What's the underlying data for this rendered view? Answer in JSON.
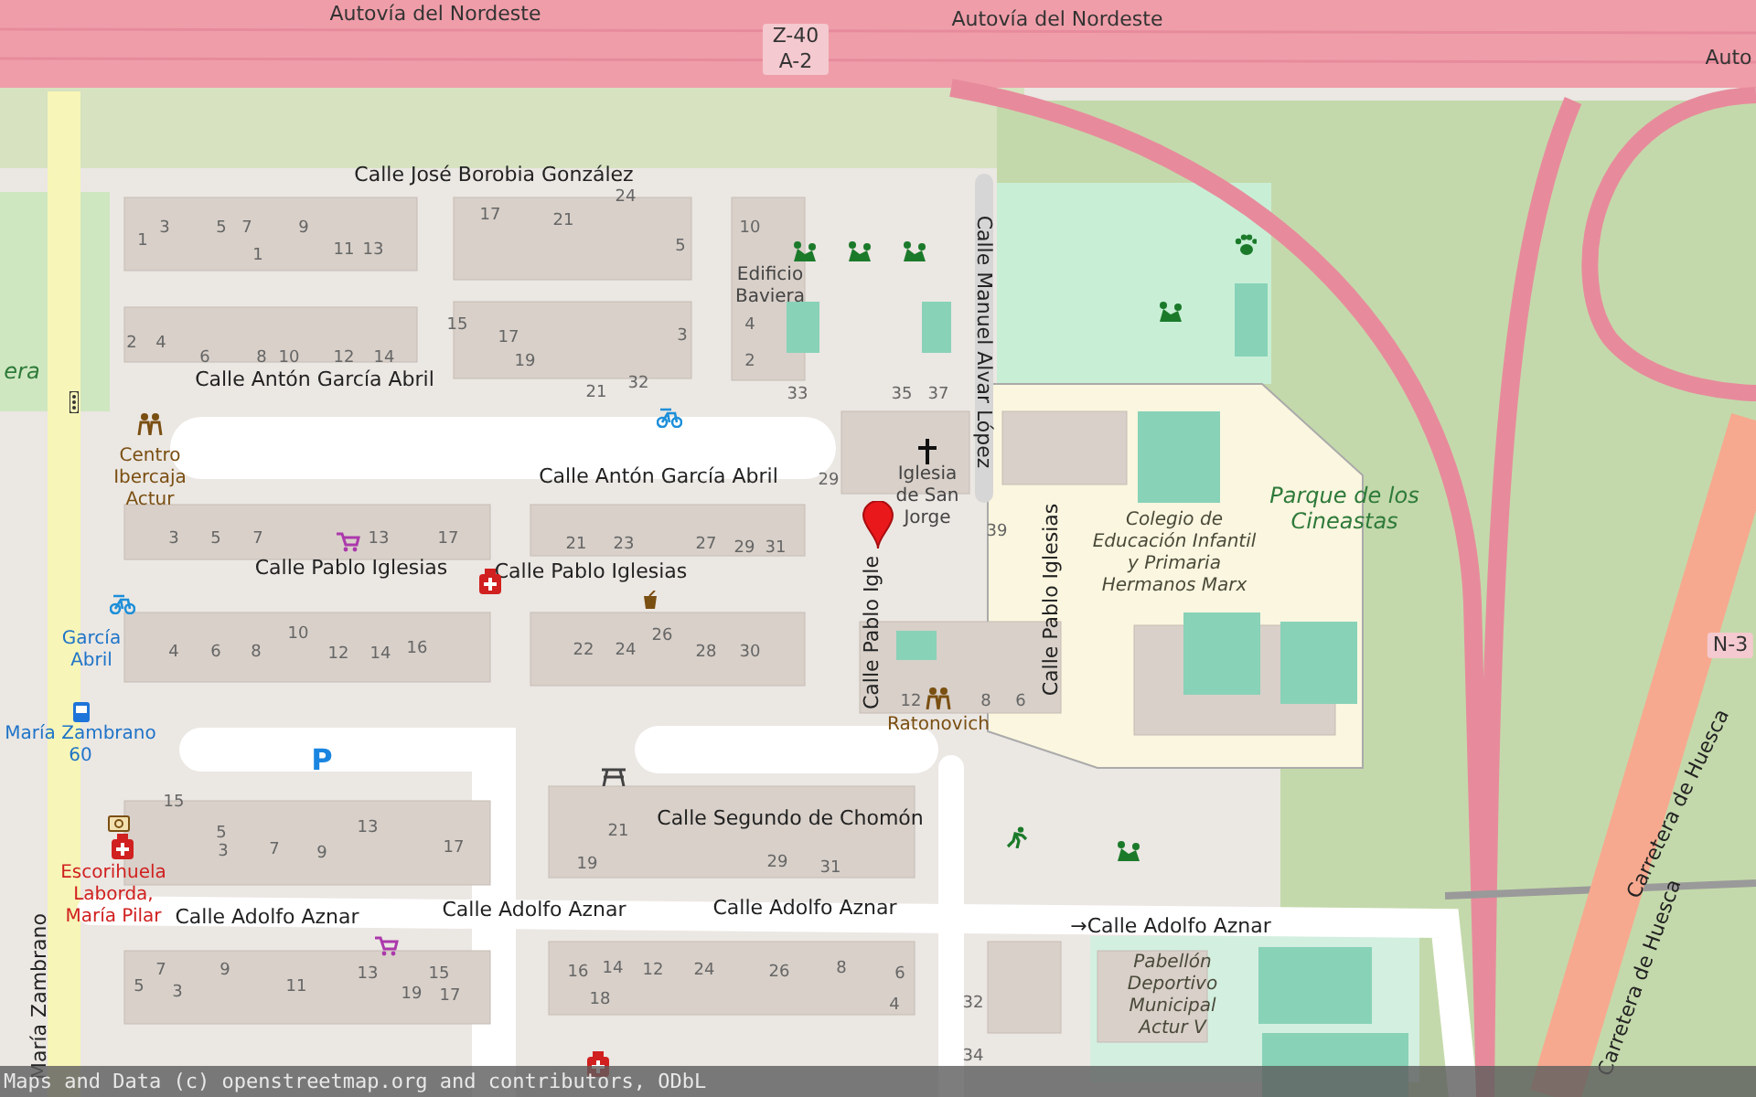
{
  "map": {
    "labels": [
      {
        "text": "Autovía del Nordeste",
        "kind": "road"
      },
      {
        "text": "Autovía del Nordeste",
        "kind": "road"
      },
      {
        "text": "Auto",
        "kind": "road"
      },
      {
        "text": "Z-40 A-2",
        "kind": "shield"
      },
      {
        "text": "Calle José Borobia González",
        "kind": "street"
      },
      {
        "text": "Calle Antón García Abril",
        "kind": "street"
      },
      {
        "text": "Calle Antón García Abril",
        "kind": "street"
      },
      {
        "text": "Calle Pablo Iglesias",
        "kind": "street"
      },
      {
        "text": "Calle Pablo Iglesias",
        "kind": "street"
      },
      {
        "text": "Calle Manuel Alvar López",
        "kind": "street"
      },
      {
        "text": "Calle Pablo Igle",
        "kind": "street"
      },
      {
        "text": "Calle Pablo Iglesias",
        "kind": "street"
      },
      {
        "text": "Calle Segundo de Chomón",
        "kind": "street"
      },
      {
        "text": "Calle Adolfo Aznar",
        "kind": "street"
      },
      {
        "text": "Calle Adolfo Aznar",
        "kind": "street"
      },
      {
        "text": "Calle Adolfo Aznar",
        "kind": "street"
      },
      {
        "text": "→Calle Adolfo Aznar",
        "kind": "street"
      },
      {
        "text": "María Zambrano",
        "kind": "street"
      },
      {
        "text": "Carretera de Huesca",
        "kind": "street"
      },
      {
        "text": "Carretera de Huesca",
        "kind": "street"
      },
      {
        "text": "N-3",
        "kind": "shield"
      },
      {
        "text": "Centro Ibercaja Actur",
        "kind": "amenity"
      },
      {
        "text": "Edificio Baviera",
        "kind": "building"
      },
      {
        "text": "Iglesia de San Jorge",
        "kind": "building"
      },
      {
        "text": "Colegio de Educación Infantil y Primaria Hermanos Marx",
        "kind": "school"
      },
      {
        "text": "Parque de los Cineastas",
        "kind": "park"
      },
      {
        "text": "Ratonovich",
        "kind": "amenity"
      },
      {
        "text": "García Abril",
        "kind": "transit"
      },
      {
        "text": "María Zambrano 60",
        "kind": "transit"
      },
      {
        "text": "Escorihuela Laborda, María Pilar",
        "kind": "health"
      },
      {
        "text": "Pabellón Deportivo Municipal Actur V",
        "kind": "school"
      },
      {
        "text": "era",
        "kind": "park"
      },
      {
        "text": "P",
        "kind": "parking"
      }
    ],
    "house_numbers": [
      "3",
      "5",
      "7",
      "9",
      "1",
      "1",
      "11",
      "13",
      "2",
      "4",
      "6",
      "8",
      "10",
      "12",
      "14",
      "17",
      "21",
      "24",
      "5",
      "15",
      "17",
      "19",
      "3",
      "21",
      "32",
      "10",
      "4",
      "2",
      "33",
      "35",
      "37",
      "29",
      "39",
      "3",
      "5",
      "7",
      "13",
      "17",
      "21",
      "23",
      "27",
      "29",
      "31",
      "10",
      "4",
      "6",
      "8",
      "12",
      "14",
      "16",
      "22",
      "24",
      "26",
      "28",
      "30",
      "12",
      "8",
      "6",
      "15",
      "5",
      "13",
      "3",
      "7",
      "9",
      "17",
      "21",
      "19",
      "29",
      "31",
      "7",
      "9",
      "5",
      "3",
      "11",
      "13",
      "15",
      "19",
      "17",
      "16",
      "14",
      "12",
      "24",
      "26",
      "8",
      "18",
      "6",
      "4",
      "32",
      "34"
    ],
    "attribution": "Maps and Data (c) openstreetmap.org and contributors, ODbL"
  }
}
